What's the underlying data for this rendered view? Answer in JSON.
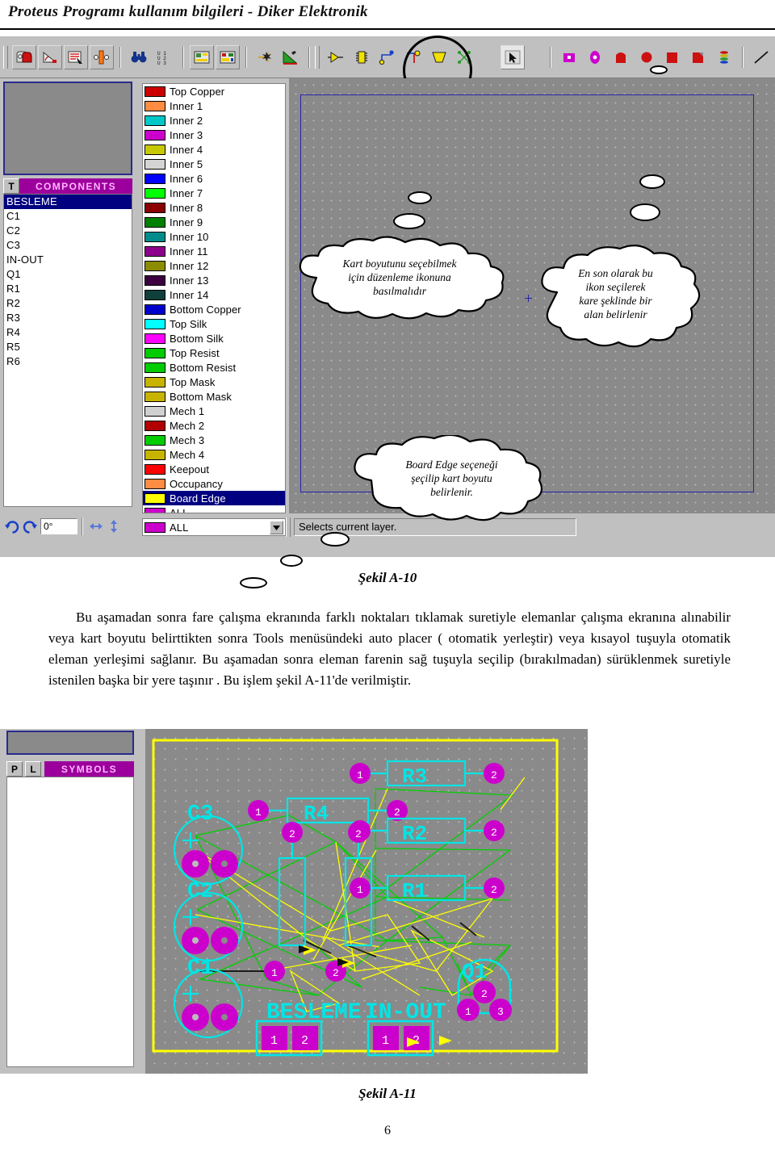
{
  "page": {
    "header": "Proteus Programı kullanım bilgileri  -  Diker  Elektronik",
    "page_number": "6"
  },
  "figure_a10": {
    "caption": "Şekil A-10",
    "toolbar": {
      "groups": [
        {
          "name": "selection-tools",
          "icons": [
            "selection-mode-icon",
            "dimension-icon",
            "ratsnest-icon",
            "connectivity-icon"
          ]
        },
        {
          "name": "view-tools",
          "icons": [
            "find-binoculars-icon",
            "layers-icon"
          ]
        },
        {
          "name": "board-tools",
          "icons": [
            "board-properties-icon",
            "netlist-icon"
          ]
        },
        {
          "name": "route-tools",
          "icons": [
            "autoroute-icon",
            "design-rule-icon"
          ]
        },
        {
          "name": "place-tools",
          "icons": [
            "component-icon",
            "package-icon",
            "track-icon",
            "via-pin-icon",
            "zone-icon",
            "ratsnest-link-icon"
          ]
        },
        {
          "name": "select-tool",
          "icons": [
            "arrow-select-icon"
          ]
        },
        {
          "name": "pad-tools",
          "icons": [
            "square-pad-icon",
            "oval-pad-icon",
            "dil-pad-icon",
            "round-pad-icon",
            "sq-pad-icon",
            "edge-pad-icon",
            "padstack-icon"
          ]
        },
        {
          "name": "draw-tools",
          "icons": [
            "line-icon",
            "box-icon",
            "circle-icon",
            "arc-icon",
            "path-icon",
            "text-icon",
            "symbol-icon"
          ]
        }
      ]
    },
    "left_panel": {
      "preview_label": "object-preview",
      "toggle_button": "T",
      "list_title": "COMPONENTS",
      "items": [
        {
          "label": "BESLEME",
          "selected": true
        },
        {
          "label": "C1",
          "selected": false
        },
        {
          "label": "C2",
          "selected": false
        },
        {
          "label": "C3",
          "selected": false
        },
        {
          "label": "IN-OUT",
          "selected": false
        },
        {
          "label": "Q1",
          "selected": false
        },
        {
          "label": "R1",
          "selected": false
        },
        {
          "label": "R2",
          "selected": false
        },
        {
          "label": "R3",
          "selected": false
        },
        {
          "label": "R4",
          "selected": false
        },
        {
          "label": "R5",
          "selected": false
        },
        {
          "label": "R6",
          "selected": false
        }
      ],
      "rotation_value": "0°",
      "rotation_icons": [
        "rotate-cw-icon",
        "rotate-ccw-icon",
        "mirror-horizontal-icon",
        "mirror-vertical-icon"
      ]
    },
    "layer_selector": {
      "layers": [
        {
          "label": "Top Copper",
          "color": "#cc0000",
          "selected": false
        },
        {
          "label": "Inner 1",
          "color": "#ff8c42",
          "selected": false
        },
        {
          "label": "Inner 2",
          "color": "#00c8c8",
          "selected": false
        },
        {
          "label": "Inner 3",
          "color": "#cc00cc",
          "selected": false
        },
        {
          "label": "Inner 4",
          "color": "#c8c800",
          "selected": false
        },
        {
          "label": "Inner 5",
          "color": "#d4d4d4",
          "selected": false
        },
        {
          "label": "Inner 6",
          "color": "#0000ff",
          "selected": false
        },
        {
          "label": "Inner 7",
          "color": "#00ff00",
          "selected": false
        },
        {
          "label": "Inner 8",
          "color": "#8b0000",
          "selected": false
        },
        {
          "label": "Inner 9",
          "color": "#008000",
          "selected": false
        },
        {
          "label": "Inner 10",
          "color": "#008c8c",
          "selected": false
        },
        {
          "label": "Inner 11",
          "color": "#8c008c",
          "selected": false
        },
        {
          "label": "Inner 12",
          "color": "#8c8c00",
          "selected": false
        },
        {
          "label": "Inner 13",
          "color": "#3c0040",
          "selected": false
        },
        {
          "label": "Inner 14",
          "color": "#10403c",
          "selected": false
        },
        {
          "label": "Bottom Copper",
          "color": "#0000cc",
          "selected": false
        },
        {
          "label": "Top Silk",
          "color": "#00ffff",
          "selected": false
        },
        {
          "label": "Bottom Silk",
          "color": "#ff00ff",
          "selected": false
        },
        {
          "label": "Top Resist",
          "color": "#00cc00",
          "selected": false
        },
        {
          "label": "Bottom Resist",
          "color": "#00cc00",
          "selected": false
        },
        {
          "label": "Top Mask",
          "color": "#c8b400",
          "selected": false
        },
        {
          "label": "Bottom Mask",
          "color": "#c8b400",
          "selected": false
        },
        {
          "label": "Mech 1",
          "color": "#d0d0d0",
          "selected": false
        },
        {
          "label": "Mech 2",
          "color": "#b00000",
          "selected": false
        },
        {
          "label": "Mech 3",
          "color": "#00cc00",
          "selected": false
        },
        {
          "label": "Mech 4",
          "color": "#c8b400",
          "selected": false
        },
        {
          "label": "Keepout",
          "color": "#ff0000",
          "selected": false
        },
        {
          "label": "Occupancy",
          "color": "#ff8c42",
          "selected": false
        },
        {
          "label": "Board Edge",
          "color": "#ffff00",
          "selected": true
        },
        {
          "label": "ALL",
          "color": "#cc00cc",
          "selected": false
        }
      ],
      "combo_value": "ALL",
      "combo_color": "#cc00cc"
    },
    "status_text": "Selects current layer.",
    "callouts": [
      {
        "name": "callout-edit-icon",
        "lines": [
          "Kart boyutunu seçebilmek",
          "için düzenleme ikonuna",
          "basılmalıdır"
        ]
      },
      {
        "name": "callout-box-icon",
        "lines": [
          "En son olarak bu",
          "ikon seçilerek",
          "kare şeklinde bir",
          "alan belirlenir"
        ]
      },
      {
        "name": "callout-board-edge",
        "lines": [
          "Board Edge seçeneği",
          "şeçilip kart boyutu",
          "belirlenir."
        ]
      }
    ]
  },
  "body_text": "Bu aşamadan sonra fare çalışma ekranında farklı noktaları tıklamak suretiyle elemanlar çalışma ekranına alınabilir veya kart boyutu belirttikten sonra Tools menüsündeki auto placer ( otomatik yerleştir) veya kısayol tuşuyla  otomatik eleman yerleşimi sağlanır. Bu aşamadan sonra eleman farenin sağ tuşuyla seçilip (bırakılmadan) sürüklenmek suretiyle istenilen başka bir yere taşınır . Bu işlem şekil A-11'de verilmiştir.",
  "figure_a11": {
    "caption": "Şekil A-11",
    "left_panel": {
      "buttons": [
        "P",
        "L"
      ],
      "list_title": "SYMBOLS"
    },
    "pcb": {
      "board_edge_color": "#ffff00",
      "silk_color": "#00e5e5",
      "pad_color": "#cc00cc",
      "ratsnest_color": "#00d000",
      "track_color": "#ffff00",
      "components": [
        {
          "ref": "C3",
          "type": "capacitor"
        },
        {
          "ref": "C2",
          "type": "capacitor"
        },
        {
          "ref": "C1",
          "type": "capacitor"
        },
        {
          "ref": "R4",
          "type": "resistor"
        },
        {
          "ref": "R3",
          "type": "resistor"
        },
        {
          "ref": "R2",
          "type": "resistor"
        },
        {
          "ref": "R1",
          "type": "resistor"
        },
        {
          "ref": "BESLEME",
          "type": "connector"
        },
        {
          "ref": "IN-OUT",
          "type": "connector"
        },
        {
          "ref": "Q1",
          "type": "transistor"
        }
      ],
      "pad_numbers": [
        "1",
        "2",
        "3"
      ]
    }
  }
}
